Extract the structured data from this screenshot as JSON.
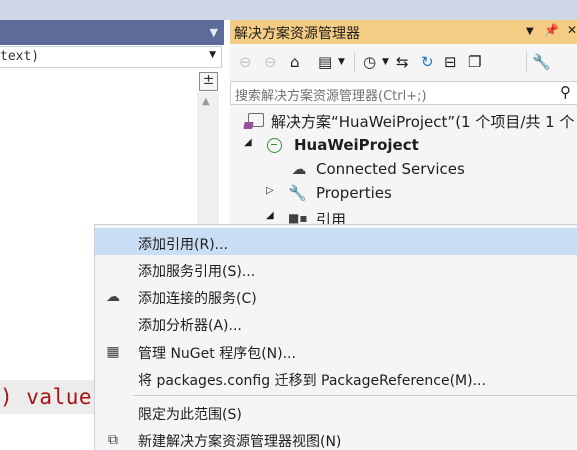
{
  "editor": {
    "nav_combo_text": "text)",
    "code_fragment": ") value"
  },
  "solution_explorer": {
    "title": "解决方案资源管理器",
    "search_placeholder": "搜索解决方案资源管理器(Ctrl+;)",
    "tree": [
      {
        "label": "解决方案“HuaWeiProject”(1 个项目/共 1 个",
        "level": 0,
        "bold": false,
        "icon": "solution-icon"
      },
      {
        "label": "HuaWeiProject",
        "level": 1,
        "bold": true,
        "icon": "web-project-icon",
        "expanded": true
      },
      {
        "label": "Connected Services",
        "level": 2,
        "bold": false,
        "icon": "connected-services-icon"
      },
      {
        "label": "Properties",
        "level": 2,
        "bold": false,
        "icon": "wrench-icon",
        "expanded": false
      },
      {
        "label": "引用",
        "level": 2,
        "bold": false,
        "icon": "references-icon",
        "expanded": true
      }
    ]
  },
  "context_menu": {
    "items": [
      {
        "label": "添加引用(R)...",
        "icon": "",
        "highlighted": true
      },
      {
        "label": "添加服务引用(S)...",
        "icon": ""
      },
      {
        "label": "添加连接的服务(C)",
        "icon": "connected-service-icon"
      },
      {
        "label": "添加分析器(A)...",
        "icon": ""
      },
      {
        "label": "管理 NuGet 程序包(N)...",
        "icon": "nuget-package-icon"
      },
      {
        "label": "将 packages.config 迁移到 PackageReference(M)...",
        "icon": ""
      },
      {
        "label": "限定为此范围(S)",
        "icon": ""
      },
      {
        "label": "新建解决方案资源管理器视图(N)",
        "icon": "new-view-icon"
      }
    ]
  }
}
